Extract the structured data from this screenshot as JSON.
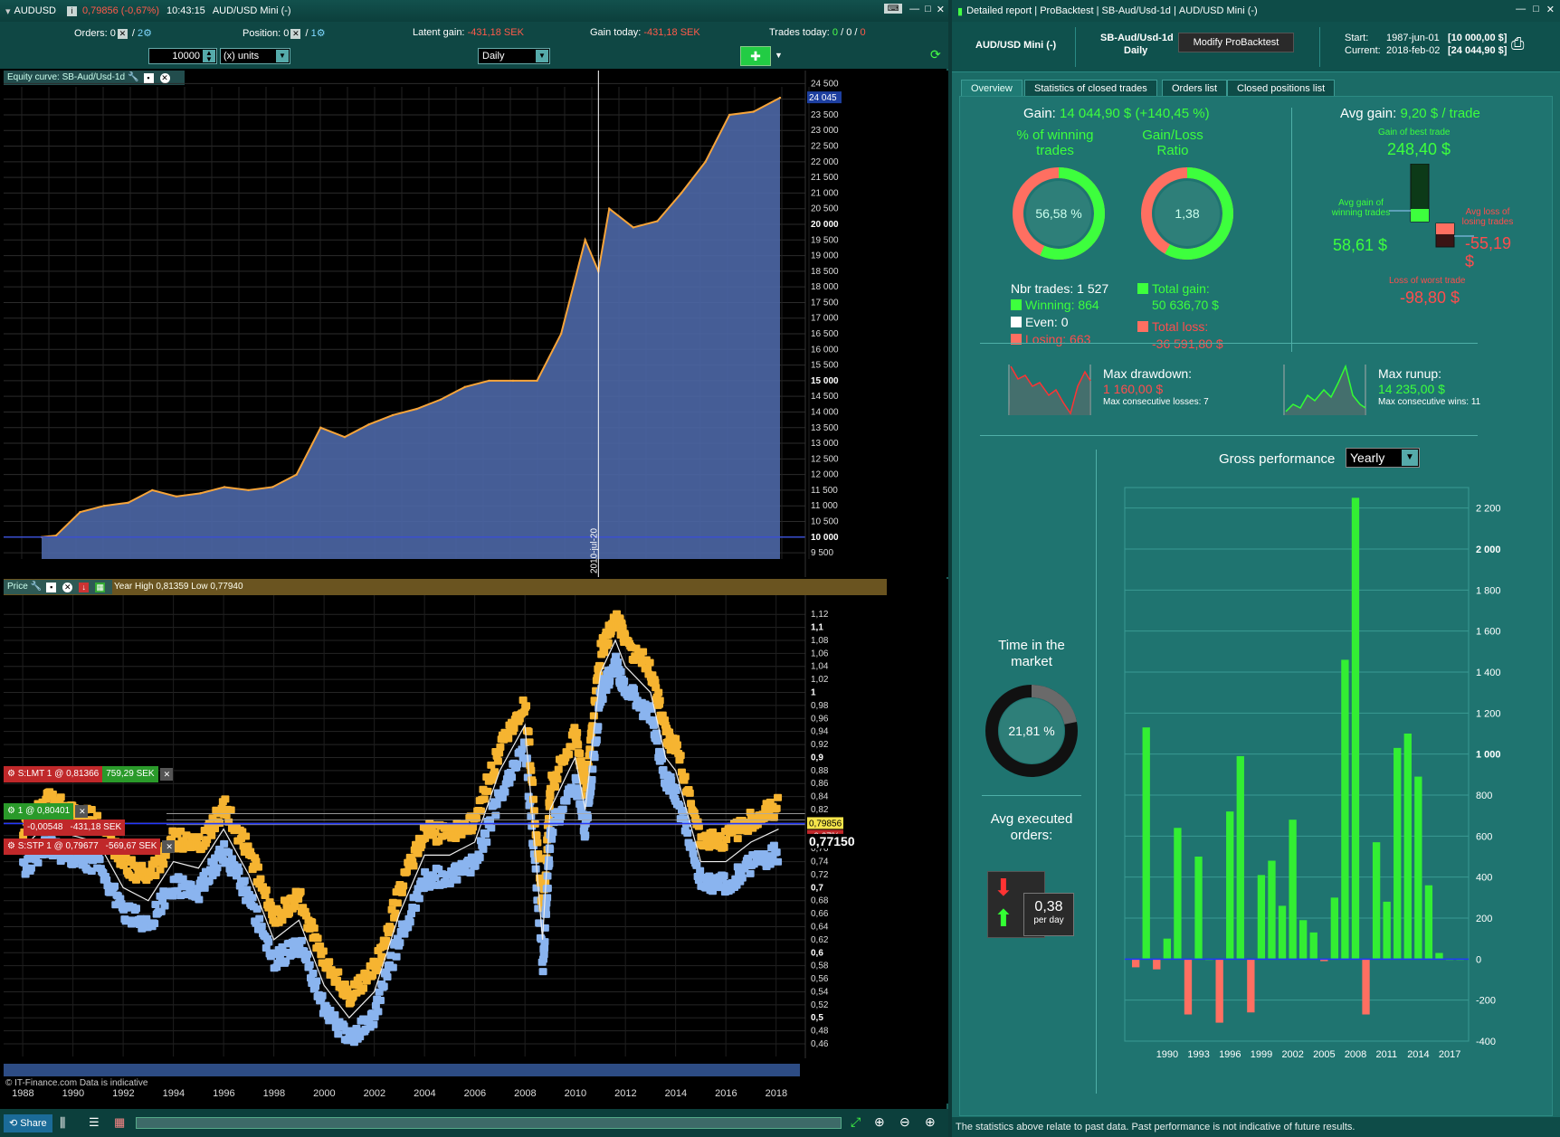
{
  "left": {
    "title": {
      "symbol": "AUDUSD",
      "price": "0,79856 (-0,67%)",
      "time": "10:43:15",
      "instrument": "AUD/USD Mini (-)"
    },
    "status": {
      "orders_label": "Orders:",
      "orders_a": "0",
      "orders_b": "2",
      "position_label": "Position:",
      "position_a": "0",
      "position_b": "1",
      "latent_label": "Latent gain:",
      "latent_value": "-431,18 SEK",
      "today_label": "Gain today:",
      "today_value": "-431,18 SEK",
      "trades_label": "Trades today:",
      "trades_a": "0",
      "trades_b": "0",
      "trades_c": "0"
    },
    "controls": {
      "quantity": "10000",
      "units": "(x) units",
      "period": "Daily"
    },
    "equity": {
      "title": "Equity curve: SB-Aud/Usd-1d",
      "current": "24 045",
      "cursor_date": "2010-jul-20",
      "yticks": [
        "24 500",
        "24 000",
        "23 500",
        "23 000",
        "22 500",
        "22 000",
        "21 500",
        "21 000",
        "20 500",
        "20 000",
        "19 500",
        "19 000",
        "18 500",
        "18 000",
        "17 500",
        "17 000",
        "16 500",
        "16 000",
        "15 500",
        "15 000",
        "14 500",
        "14 000",
        "13 500",
        "13 000",
        "12 500",
        "12 000",
        "11 500",
        "11 000",
        "10 500",
        "10 000",
        "9 500"
      ]
    },
    "price": {
      "title": "Price",
      "info": "Year High 0,81359 Low 0,77940",
      "yticks": [
        "1,12",
        "1,1",
        "1,08",
        "1,06",
        "1,04",
        "1,02",
        "1",
        "0,98",
        "0,96",
        "0,94",
        "0,92",
        "0,9",
        "0,88",
        "0,86",
        "0,84",
        "0,82",
        "0,8",
        "0,78",
        "0,76",
        "0,74",
        "0,72",
        "0,7",
        "0,68",
        "0,66",
        "0,64",
        "0,62",
        "0,6",
        "0,58",
        "0,56",
        "0,54",
        "0,52",
        "0,5",
        "0,48",
        "0,46"
      ],
      "last": "0,77150",
      "tag_price": "0,79856",
      "tag_change": "-0,67%",
      "orders": [
        {
          "label": "S:LMT  1 @ 0,81366",
          "value": "759,29 SEK"
        },
        {
          "label": "1 @ 0,80401",
          "value": ""
        },
        {
          "label": "-0,00548",
          "value": "-431,18 SEK"
        },
        {
          "label": "S:STP  1 @ 0,79677",
          "value": "-569,67 SEK"
        }
      ],
      "credit": "© IT-Finance.com Data is indicative",
      "xlabels": [
        "1988",
        "1990",
        "1992",
        "1994",
        "1996",
        "1998",
        "2000",
        "2002",
        "2004",
        "2006",
        "2008",
        "2010",
        "2012",
        "2014",
        "2016",
        "2018"
      ]
    },
    "bottom": {
      "share": "Share"
    }
  },
  "right": {
    "title": {
      "t1": "Detailed report",
      "t2": "ProBacktest",
      "t3": "SB-Aud/Usd-1d",
      "t4": "AUD/USD Mini (-)"
    },
    "header": {
      "instrument": "AUD/USD Mini (-)",
      "system": "SB-Aud/Usd-1d",
      "period": "Daily",
      "modify": "Modify ProBacktest",
      "start_label": "Start:",
      "start_date": "1987-jun-01",
      "start_value": "[10 000,00 $]",
      "current_label": "Current:",
      "current_date": "2018-feb-02",
      "current_value": "[24 044,90 $]"
    },
    "tabs": [
      "Overview",
      "Statistics of closed trades",
      "Orders list",
      "Closed positions list"
    ],
    "gain_label": "Gain:",
    "gain_value": "14 044,90 $ (+140,45 %)",
    "winning_title": "% of winning trades",
    "winning_pct": "56,58 %",
    "winning_frac": 0.5658,
    "ratio_title": "Gain/Loss Ratio",
    "ratio_value": "1,38",
    "ratio_frac": 0.58,
    "nbr_trades": "Nbr trades: 1 527",
    "winning": "Winning: 864",
    "even": "Even: 0",
    "losing": "Losing: 663",
    "total_gain_label": "Total gain:",
    "total_gain": "50 636,70 $",
    "total_loss_label": "Total loss:",
    "total_loss": "-36 591,80 $",
    "avg_gain_label": "Avg gain:",
    "avg_gain_value": "9,20 $ / trade",
    "best_label": "Gain of best trade",
    "best_value": "248,40 $",
    "avg_win_label": "Avg gain of winning trades",
    "avg_win_value": "58,61 $",
    "avg_loss_label": "Avg loss of losing trades",
    "avg_loss_value": "-55,19 $",
    "worst_label": "Loss of worst trade",
    "worst_value": "-98,80 $",
    "drawdown_label": "Max drawdown:",
    "drawdown_value": "1 160,00 $",
    "cons_losses": "Max consecutive losses: 7",
    "runup_label": "Max runup:",
    "runup_value": "14 235,00 $",
    "cons_wins": "Max consecutive wins: 11",
    "time_market_label": "Time in the market",
    "time_market_value": "21,81 %",
    "time_market_frac": 0.2181,
    "avg_orders_label": "Avg executed orders:",
    "avg_orders_value": "0,38",
    "avg_orders_unit": "per day",
    "perf_label": "Gross performance",
    "perf_select": "Yearly",
    "footer": "The statistics above relate to past data. Past performance is not indicative of future results."
  },
  "chart_data": [
    {
      "type": "area",
      "title": "Equity curve: SB-Aud/Usd-1d",
      "x": [
        1987.4,
        1988,
        1989,
        1990,
        1991,
        1992,
        1993,
        1994,
        1995,
        1996,
        1997,
        1998,
        1999,
        2000,
        2001,
        2002,
        2003,
        2004,
        2005,
        2006,
        2007,
        2008,
        2009,
        2010,
        2010.55,
        2011,
        2012,
        2013,
        2014,
        2015,
        2016,
        2017,
        2018.1
      ],
      "y": [
        10000,
        10050,
        10800,
        11000,
        11100,
        11500,
        11300,
        11400,
        11600,
        11500,
        11600,
        12000,
        13500,
        13200,
        13600,
        13900,
        14100,
        14400,
        14800,
        15000,
        15000,
        15000,
        16500,
        19500,
        18500,
        20500,
        19900,
        20100,
        21000,
        22000,
        23500,
        23600,
        24045
      ],
      "ylim": [
        9300,
        24800
      ],
      "grid": true
    },
    {
      "type": "bar",
      "title": "Gross performance",
      "categories": [
        "1987",
        "1988",
        "1989",
        "1990",
        "1991",
        "1992",
        "1993",
        "1994",
        "1995",
        "1996",
        "1997",
        "1998",
        "1999",
        "2000",
        "2001",
        "2002",
        "2003",
        "2004",
        "2005",
        "2006",
        "2007",
        "2008",
        "2009",
        "2010",
        "2011",
        "2012",
        "2013",
        "2014",
        "2015",
        "2016",
        "2017",
        "2018"
      ],
      "values": [
        -40,
        1130,
        -50,
        100,
        640,
        -270,
        500,
        0,
        -310,
        720,
        990,
        -260,
        410,
        480,
        260,
        680,
        190,
        130,
        -10,
        300,
        1460,
        2250,
        -270,
        570,
        280,
        1030,
        1100,
        890,
        360,
        30,
        0,
        0
      ],
      "xlabels": [
        "1990",
        "1993",
        "1996",
        "1999",
        "2002",
        "2005",
        "2008",
        "2011",
        "2014",
        "2017"
      ],
      "yticks": [
        "2 200",
        "2 000",
        "1 800",
        "1 600",
        "1 400",
        "1 200",
        "1 000",
        "800",
        "600",
        "400",
        "200",
        "0",
        "-200",
        "-400"
      ],
      "ylim": [
        -400,
        2300
      ],
      "colors": {
        "positive": "#33ee33",
        "negative": "#ff6f61"
      },
      "grid": true
    }
  ],
  "colors": {
    "accent": "#1b6b66",
    "green": "#3dff3d",
    "red": "#ff4d4d",
    "equity_fill": "#4c67a6",
    "price_up": "#f6b431",
    "price_down": "#8ab4ef"
  }
}
